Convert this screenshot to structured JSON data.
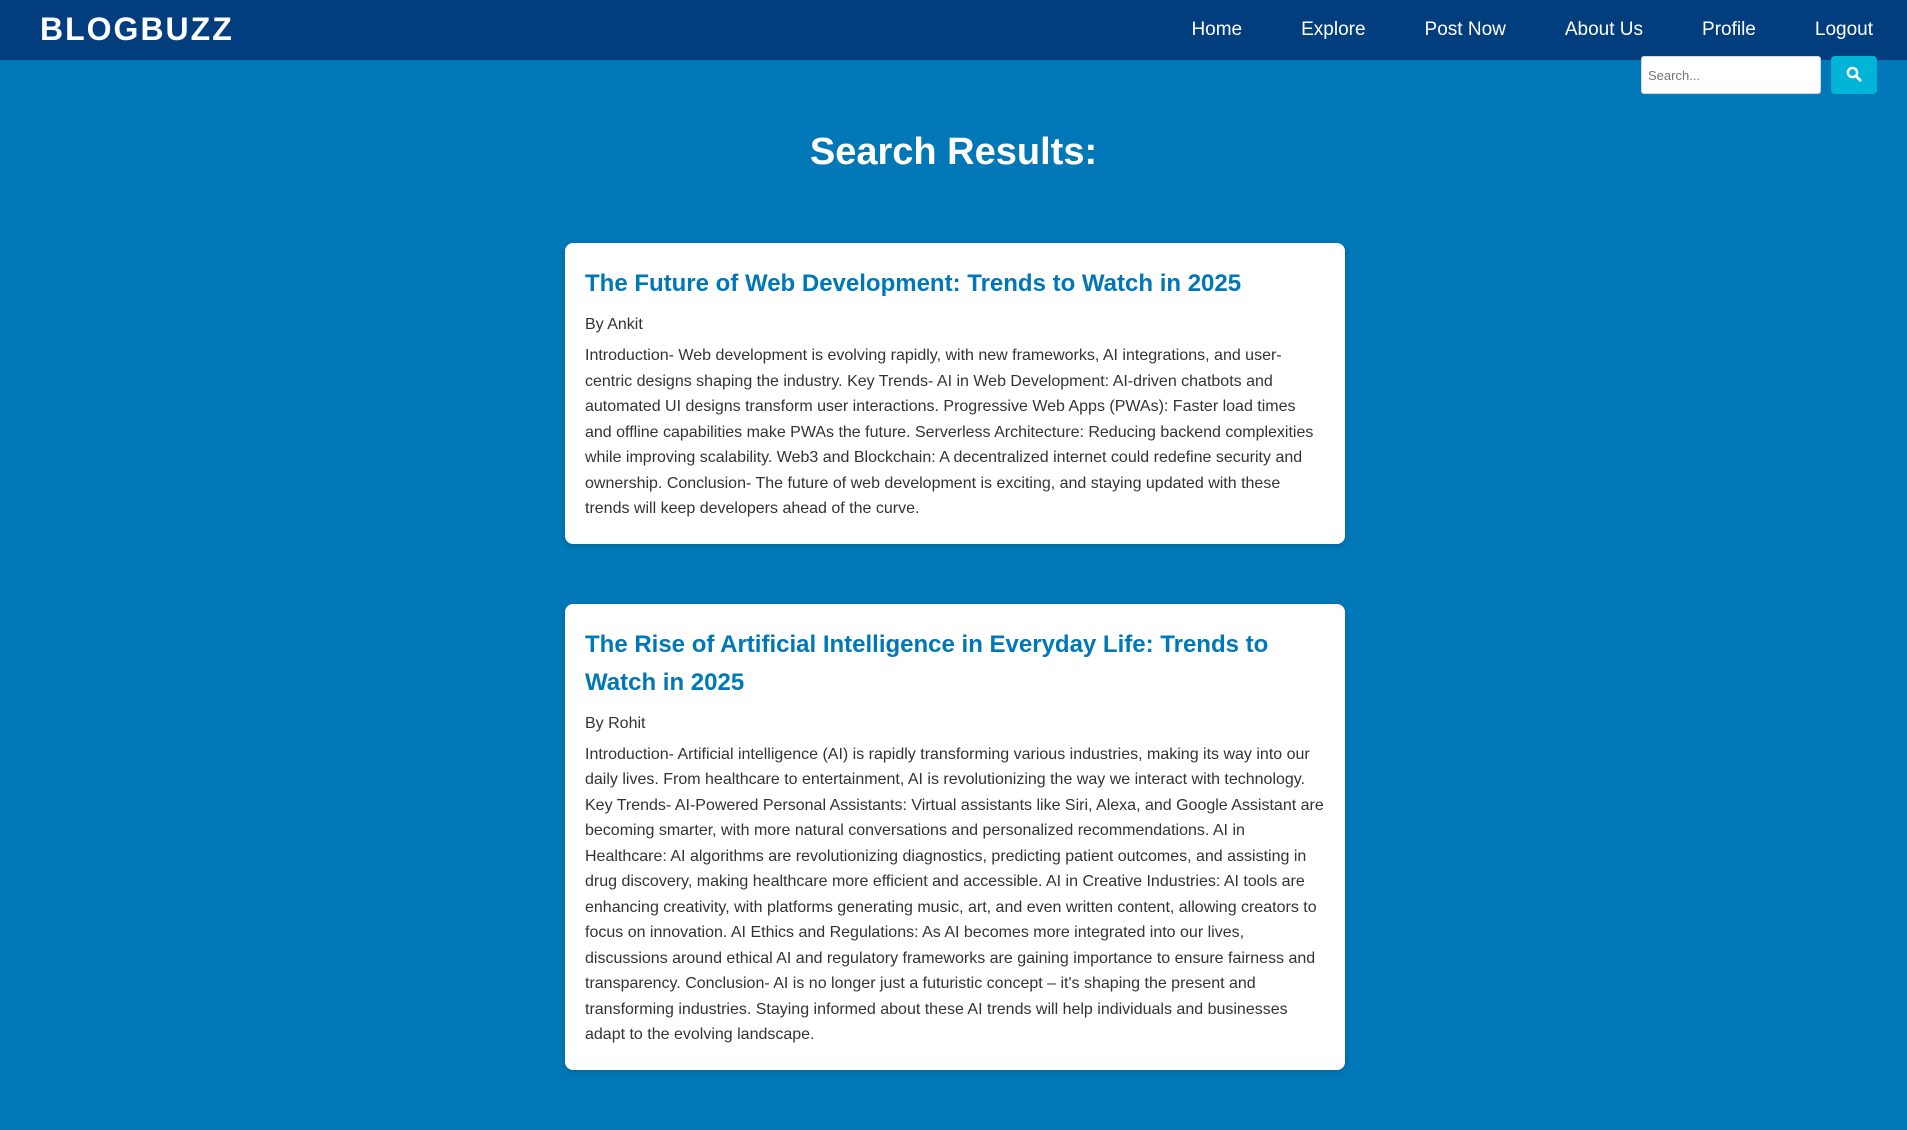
{
  "brand": "BLOGBUZZ",
  "nav": {
    "home": "Home",
    "explore": "Explore",
    "post_now": "Post Now",
    "about_us": "About Us",
    "profile": "Profile",
    "logout": "Logout"
  },
  "search": {
    "placeholder": "Search...",
    "value": "",
    "button_icon": "search-icon"
  },
  "page_title": "Search Results:",
  "colors": {
    "navbar": "#023e7d",
    "background": "#0077b6",
    "accent": "#00b4d8",
    "title_link": "#0077b6"
  },
  "results": [
    {
      "title": "The Future of Web Development: Trends to Watch in 2025",
      "author": "By Ankit",
      "excerpt": "Introduction- Web development is evolving rapidly, with new frameworks, AI integrations, and user-centric designs shaping the industry. Key Trends- AI in Web Development: AI-driven chatbots and automated UI designs transform user interactions. Progressive Web Apps (PWAs): Faster load times and offline capabilities make PWAs the future. Serverless Architecture: Reducing backend complexities while improving scalability. Web3 and Blockchain: A decentralized internet could redefine security and ownership. Conclusion- The future of web development is exciting, and staying updated with these trends will keep developers ahead of the curve."
    },
    {
      "title": "The Rise of Artificial Intelligence in Everyday Life: Trends to Watch in 2025",
      "author": "By Rohit",
      "excerpt": "Introduction- Artificial intelligence (AI) is rapidly transforming various industries, making its way into our daily lives. From healthcare to entertainment, AI is revolutionizing the way we interact with technology. Key Trends- AI-Powered Personal Assistants: Virtual assistants like Siri, Alexa, and Google Assistant are becoming smarter, with more natural conversations and personalized recommendations. AI in Healthcare: AI algorithms are revolutionizing diagnostics, predicting patient outcomes, and assisting in drug discovery, making healthcare more efficient and accessible. AI in Creative Industries: AI tools are enhancing creativity, with platforms generating music, art, and even written content, allowing creators to focus on innovation. AI Ethics and Regulations: As AI becomes more integrated into our lives, discussions around ethical AI and regulatory frameworks are gaining importance to ensure fairness and transparency. Conclusion- AI is no longer just a futuristic concept – it's shaping the present and transforming industries. Staying informed about these AI trends will help individuals and businesses adapt to the evolving landscape."
    }
  ]
}
